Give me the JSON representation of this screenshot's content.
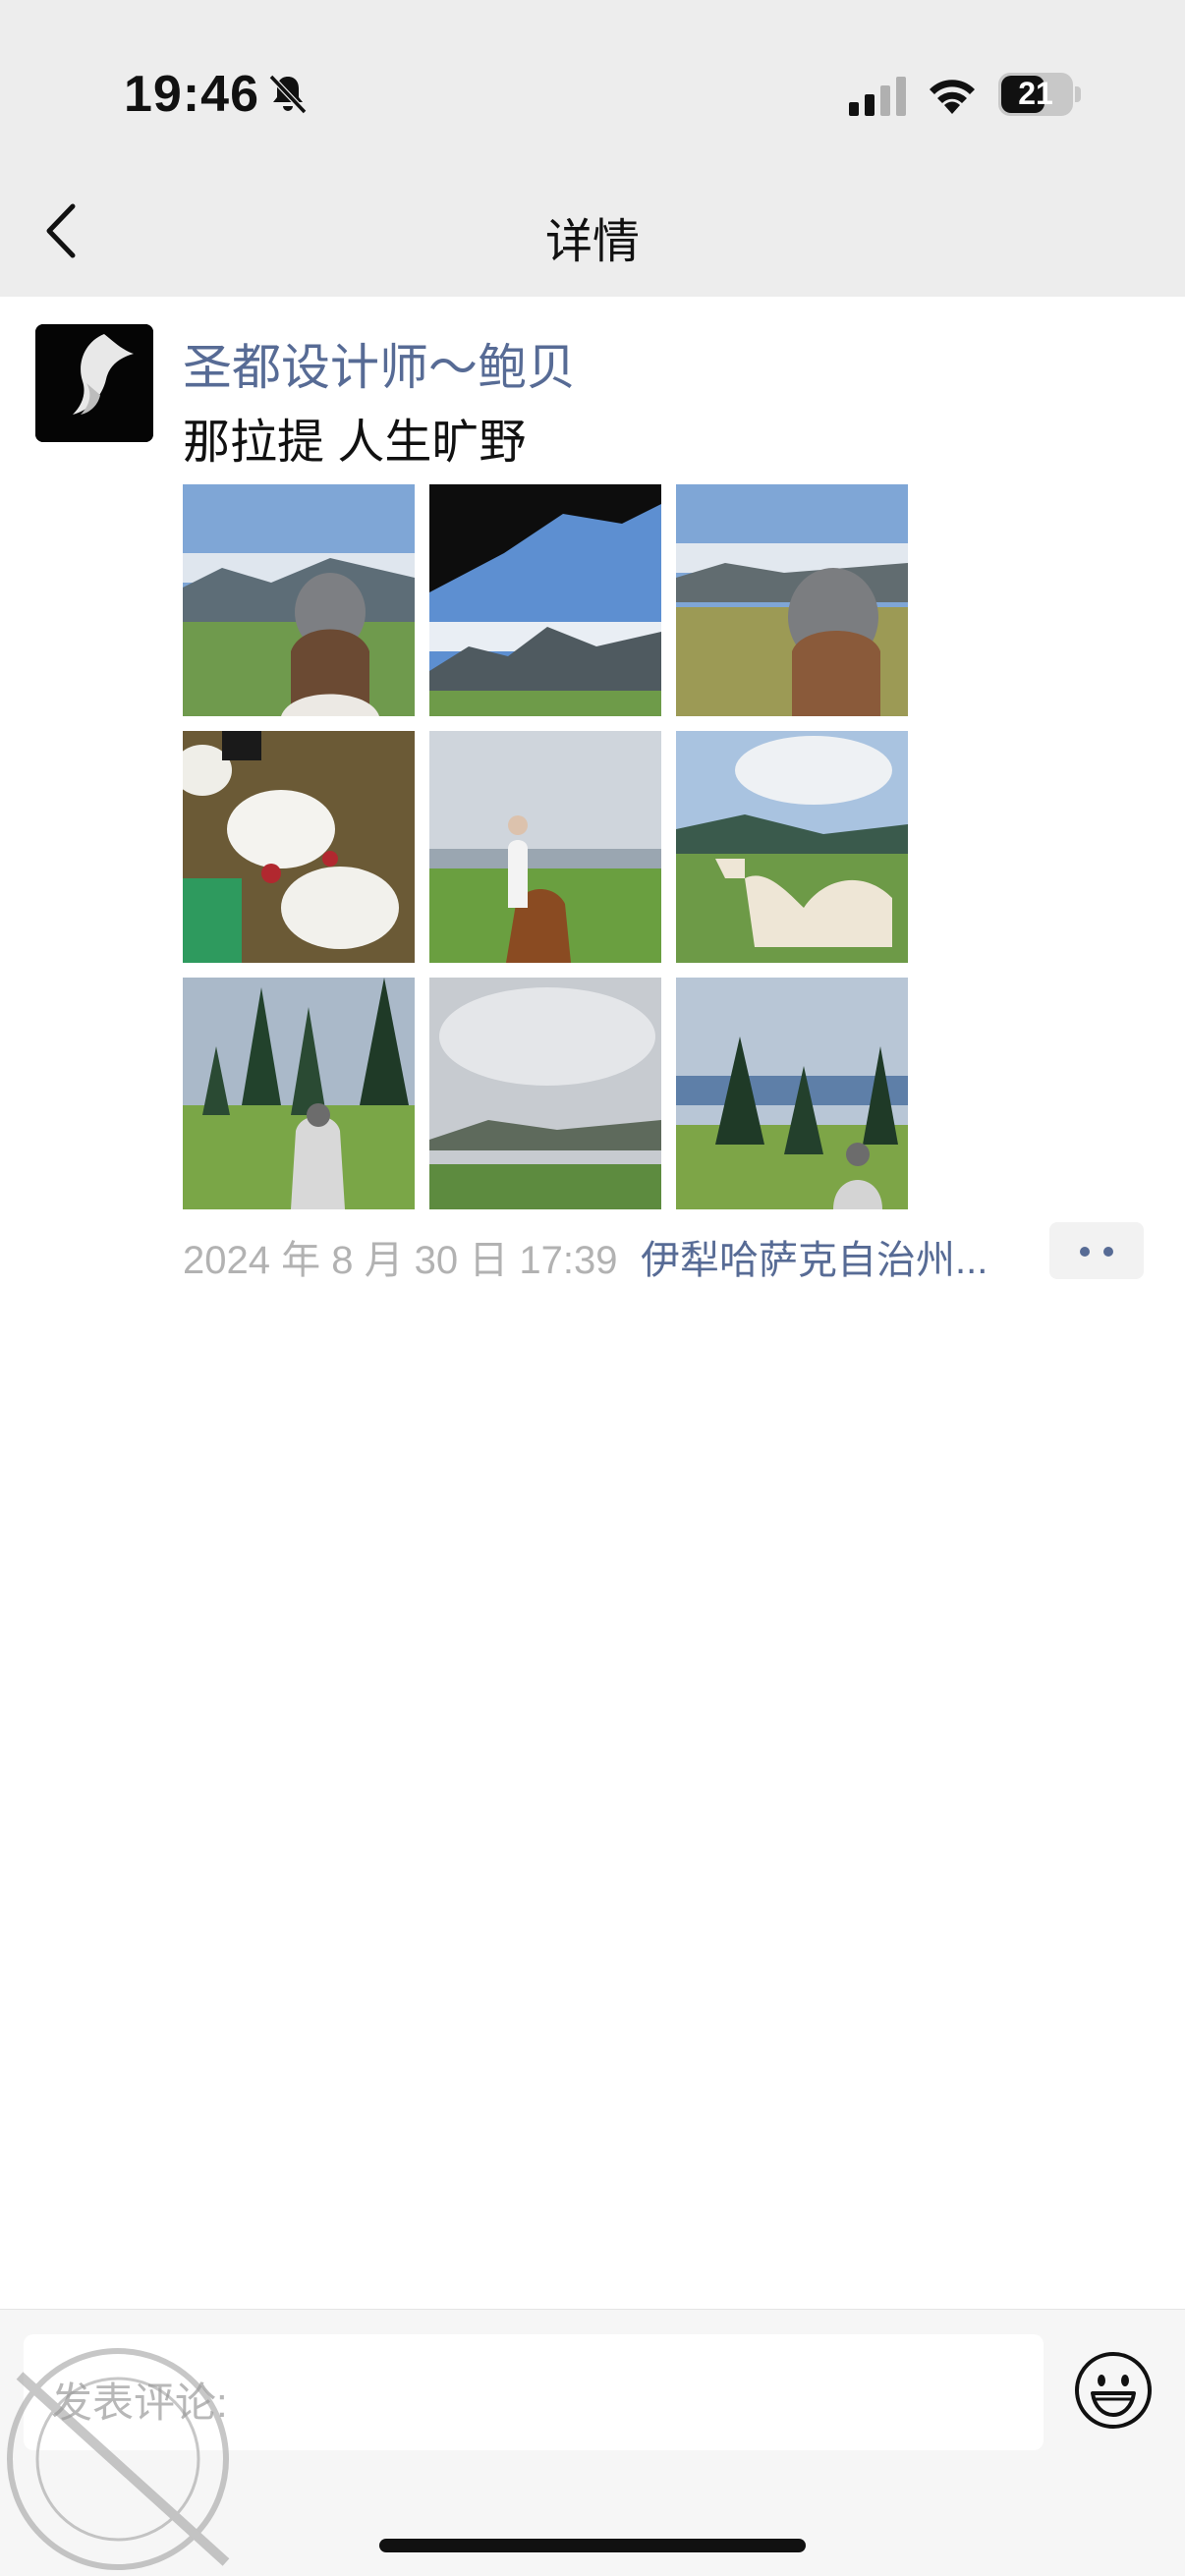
{
  "status_bar": {
    "time": "19:46",
    "battery": "21"
  },
  "nav": {
    "title": "详情"
  },
  "post": {
    "author": "圣都设计师～鲍贝",
    "text": "那拉提 人生旷野",
    "photos": [
      {
        "name": "photo-woman-grassland-1",
        "sky": "#7fa6d6"
      },
      {
        "name": "photo-mountains-roof",
        "sky": "#5d8fd1"
      },
      {
        "name": "photo-woman-grassland-2",
        "sky": "#7fa6d6"
      },
      {
        "name": "photo-sheep",
        "sky": "#6b5a36"
      },
      {
        "name": "photo-horse-rider",
        "sky": "#cfd5dc"
      },
      {
        "name": "photo-camel",
        "sky": "#a9c3e0"
      },
      {
        "name": "photo-woman-forest",
        "sky": "#aab9c9"
      },
      {
        "name": "photo-cloudy-hills",
        "sky": "#c7cbd0"
      },
      {
        "name": "photo-woman-trees",
        "sky": "#b8c6d6"
      }
    ],
    "timestamp": "2024 年 8 月 30 日 17:39",
    "location": "伊犁哈萨克自治州..."
  },
  "comment_bar": {
    "placeholder": "发表评论:"
  },
  "colors": {
    "link": "#576b95",
    "bar_bg": "#ededed"
  }
}
